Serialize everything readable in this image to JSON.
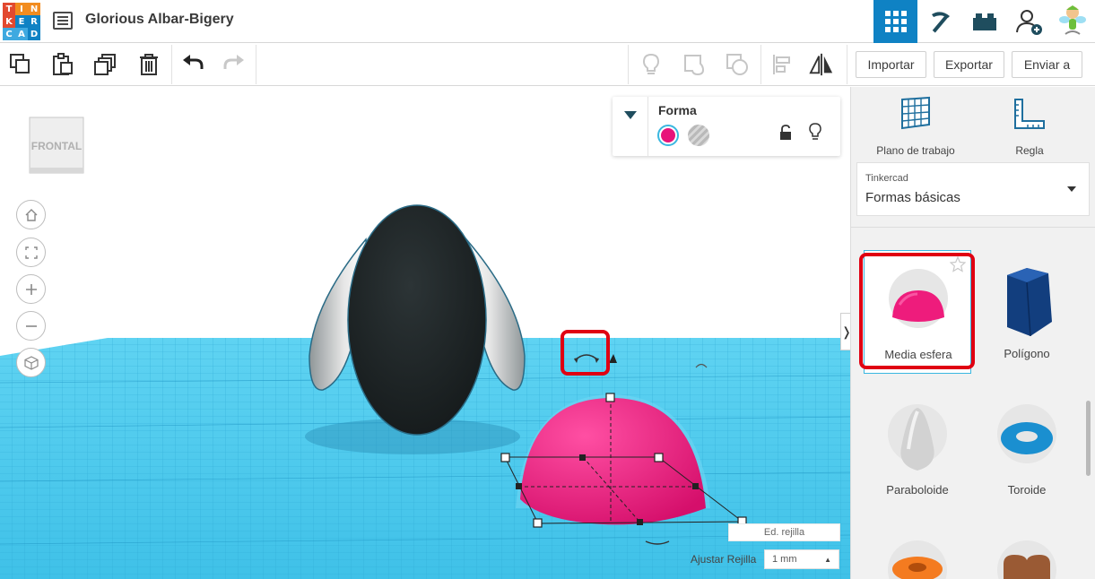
{
  "header": {
    "logo_letters": [
      "T",
      "I",
      "N",
      "K",
      "E",
      "R",
      "C",
      "A",
      "D"
    ],
    "logo_colors": [
      "#e2492f",
      "#f28c1f",
      "#f28c1f",
      "#e2492f",
      "#0f82c4",
      "#0f82c4",
      "#3fa9e0",
      "#3fa9e0",
      "#0f82c4"
    ],
    "doc_title": "Glorious Albar-Bigery",
    "views": [
      {
        "icon": "grid-view-icon",
        "active": true
      },
      {
        "icon": "pickaxe-icon",
        "active": false
      },
      {
        "icon": "brick-icon",
        "active": false
      },
      {
        "icon": "add-user-icon",
        "active": false
      },
      {
        "icon": "avatar-icon",
        "active": false
      }
    ]
  },
  "toolbar": {
    "tools": [
      "copy-icon",
      "paste-icon",
      "duplicate-icon",
      "trash-icon",
      "undo-icon",
      "redo-icon"
    ],
    "right_tools": [
      "light-bulb-icon",
      "group-icon",
      "ungroup-icon",
      "align-icon",
      "mirror-icon"
    ],
    "import_label": "Importar",
    "export_label": "Exportar",
    "send_label": "Enviar a"
  },
  "viewport": {
    "view_cube_label": "FRONTAL",
    "nav": [
      "home-icon",
      "fit-icon",
      "zoom-in-icon",
      "zoom-out-icon",
      "perspective-icon"
    ],
    "inspector": {
      "title": "Forma",
      "solid_color": "#e8137a",
      "hole_color": "#b0b0b0"
    },
    "grid_edit_label": "Ed. rejilla",
    "snap_label": "Ajustar Rejilla",
    "snap_value": "1 mm",
    "colors": {
      "workplane": "#4cc9ec",
      "grid_line": "#2aa6d0",
      "body_dark": "#1e2426",
      "ear_light": "#e4e4e4",
      "hemisphere": "#ee1c7c"
    }
  },
  "panel": {
    "workplane_label": "Plano de trabajo",
    "ruler_label": "Regla",
    "library_small": "Tinkercad",
    "library_name": "Formas básicas",
    "shapes": [
      {
        "name": "Media esfera",
        "highlight": true
      },
      {
        "name": "Polígono",
        "highlight": false
      },
      {
        "name": "Paraboloide",
        "highlight": false
      },
      {
        "name": "Toroide",
        "highlight": false
      }
    ]
  }
}
